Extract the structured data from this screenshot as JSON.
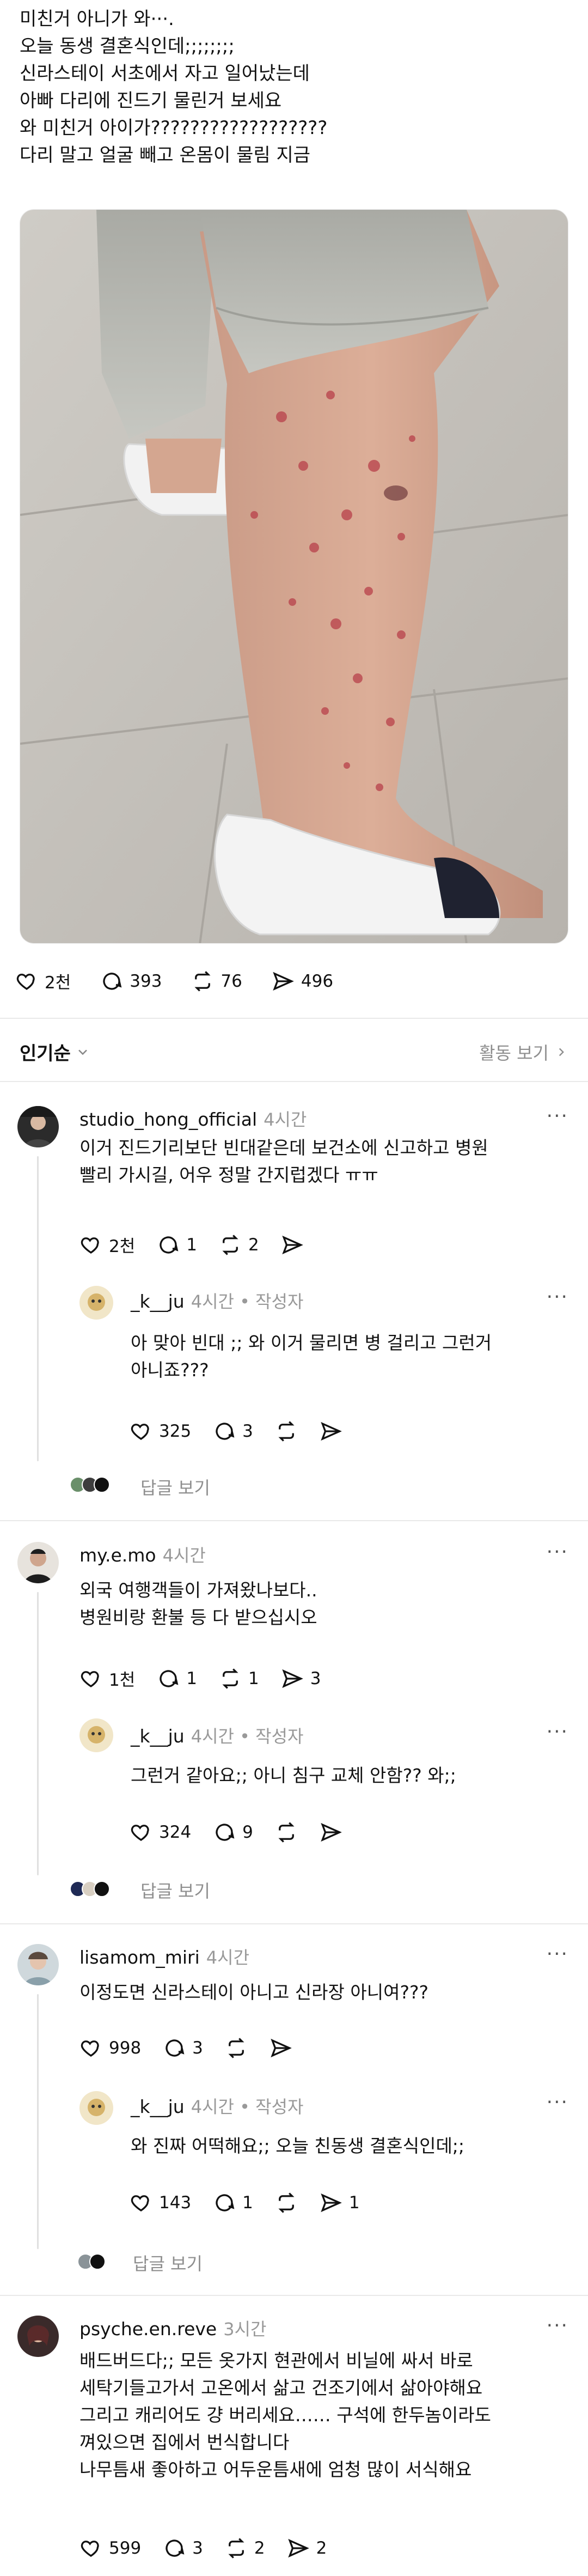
{
  "post": {
    "lines": [
      "미친거 아니가 와···.",
      "오늘 동생 결혼식인데;;;;;;;;",
      "신라스테이 서초에서 자고 일어났는데",
      "아빠 다리에 진드기 물린거 보세요",
      "와 미친거 아이가??????????????????",
      "다리 말고 얼굴 빼고 온몸이 물림 지금"
    ],
    "likes": "2천",
    "comments": "393",
    "reposts": "76",
    "shares": "496"
  },
  "sort": {
    "label": "인기순",
    "activity": "활동 보기"
  },
  "comments": [
    {
      "username": "studio_hong_official",
      "time": "4시간",
      "lines": [
        "이거 진드기리보단 빈대같은데 보건소에 신고하고 병원",
        "빨리 가시길, 어우 정말 간지럽겠다 ㅠㅠ"
      ],
      "likes": "2천",
      "replies": "1",
      "reposts": "2",
      "shares": "",
      "reply": {
        "username": "_k__ju",
        "time": "4시간 • 작성자",
        "lines": [
          "아 맞아 빈대 ;; 와 이거 물리면 병 걸리고 그런거",
          "아니죠???"
        ],
        "likes": "325",
        "replies": "3",
        "reposts": "",
        "shares": ""
      },
      "see_replies": "답글 보기"
    },
    {
      "username": "my.e.mo",
      "time": "4시간",
      "lines": [
        "외국 여행객들이 가져왔나보다..",
        "병원비랑 환불 등 다 받으십시오"
      ],
      "likes": "1천",
      "replies": "1",
      "reposts": "1",
      "shares": "3",
      "reply": {
        "username": "_k__ju",
        "time": "4시간 • 작성자",
        "lines": [
          "그런거 같아요;; 아니 침구 교체 안함?? 와;;"
        ],
        "likes": "324",
        "replies": "9",
        "reposts": "",
        "shares": ""
      },
      "see_replies": "답글 보기"
    },
    {
      "username": "lisamom_miri",
      "time": "4시간",
      "lines": [
        "이정도면 신라스테이 아니고 신라장 아니여???"
      ],
      "likes": "998",
      "replies": "3",
      "reposts": "",
      "shares": "",
      "reply": {
        "username": "_k__ju",
        "time": "4시간 • 작성자",
        "lines": [
          "와 진짜 어떡해요;; 오늘 친동생 결혼식인데;;"
        ],
        "likes": "143",
        "replies": "1",
        "reposts": "",
        "shares": "1"
      },
      "see_replies": "답글 보기"
    },
    {
      "username": "psyche.en.reve",
      "time": "3시간",
      "lines": [
        "배드버드다;; 모든 옷가지 현관에서 비닐에 싸서 바로",
        "세탁기들고가서 고온에서 삶고 건조기에서 삶아야해요",
        "그리고 캐리어도 걍 버리세요…… 구석에 한두놈이라도",
        "껴있으면 집에서 번식합니다",
        "나무틈새 좋아하고 어두운틈새에 엄청 많이 서식해요"
      ],
      "likes": "599",
      "replies": "3",
      "reposts": "2",
      "shares": "2"
    }
  ],
  "colors": {
    "text": "#101010",
    "secondary": "#999999",
    "divider": "#e9e9e9",
    "thread_line": "#e0e0e0"
  }
}
